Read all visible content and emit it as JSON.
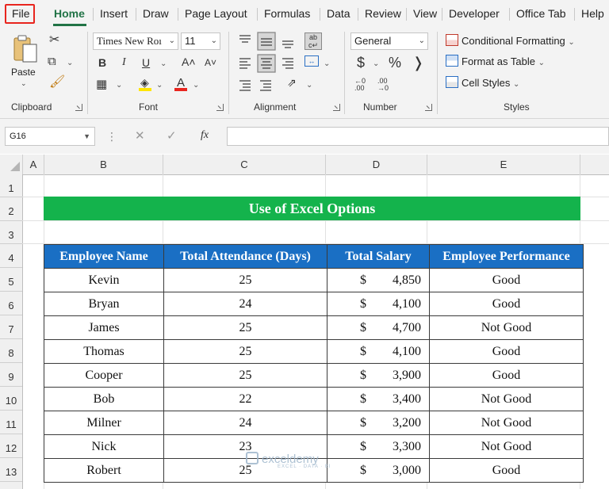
{
  "tabs": [
    "File",
    "Home",
    "Insert",
    "Draw",
    "Page Layout",
    "Formulas",
    "Data",
    "Review",
    "View",
    "Developer",
    "Office Tab",
    "Help"
  ],
  "ribbon": {
    "clipboard": {
      "paste_label": "Paste",
      "group_label": "Clipboard"
    },
    "font": {
      "font_name": "Times New Roı",
      "font_size": "11",
      "bold": "B",
      "italic": "I",
      "underline": "U",
      "grow": "A˄",
      "shrink": "A˅",
      "font_color": "A",
      "group_label": "Font"
    },
    "alignment": {
      "group_label": "Alignment"
    },
    "number": {
      "format": "General",
      "currency": "$",
      "percent": "%",
      "comma": "ⱼ",
      "inc_decimal": ".00",
      "dec_decimal": ".00",
      "group_label": "Number"
    },
    "styles": {
      "conditional": "Conditional Formatting",
      "format_table": "Format as Table",
      "cell_styles": "Cell Styles",
      "group_label": "Styles"
    }
  },
  "formula_bar": {
    "name_box": "G16",
    "fx": "fx",
    "cancel": "✕",
    "enter": "✓",
    "more": "⋮"
  },
  "columns": [
    "A",
    "B",
    "C",
    "D",
    "E"
  ],
  "rows": [
    "1",
    "2",
    "3",
    "4",
    "5",
    "6",
    "7",
    "8",
    "9",
    "10",
    "11",
    "12",
    "13"
  ],
  "sheet": {
    "title": "Use of Excel Options",
    "headers": [
      "Employee Name",
      "Total Attendance (Days)",
      "Total Salary",
      "Employee Performance"
    ],
    "currency_symbol": "$",
    "data": [
      {
        "name": "Kevin",
        "attendance": "25",
        "salary": "4,850",
        "performance": "Good"
      },
      {
        "name": "Bryan",
        "attendance": "24",
        "salary": "4,100",
        "performance": "Good"
      },
      {
        "name": "James",
        "attendance": "25",
        "salary": "4,700",
        "performance": "Not Good"
      },
      {
        "name": "Thomas",
        "attendance": "25",
        "salary": "4,100",
        "performance": "Good"
      },
      {
        "name": "Cooper",
        "attendance": "25",
        "salary": "3,900",
        "performance": "Good"
      },
      {
        "name": "Bob",
        "attendance": "22",
        "salary": "3,400",
        "performance": "Not Good"
      },
      {
        "name": "Milner",
        "attendance": "24",
        "salary": "3,200",
        "performance": "Not Good"
      },
      {
        "name": "Nick",
        "attendance": "23",
        "salary": "3,300",
        "performance": "Not Good"
      },
      {
        "name": "Robert",
        "attendance": "25",
        "salary": "3,000",
        "performance": "Good"
      }
    ]
  },
  "watermark": {
    "brand": "exceldemy",
    "tagline": "EXCEL · DATA · BI"
  },
  "colors": {
    "accent": "#217346",
    "title_band": "#14b34c",
    "header_fill": "#1a6fc4",
    "highlight": "#e8251e"
  },
  "icons": {
    "cut": "scissors-icon",
    "copy": "copy-icon",
    "format_painter": "paintbrush-icon",
    "borders": "borders-icon",
    "fill": "fill-color-icon"
  }
}
